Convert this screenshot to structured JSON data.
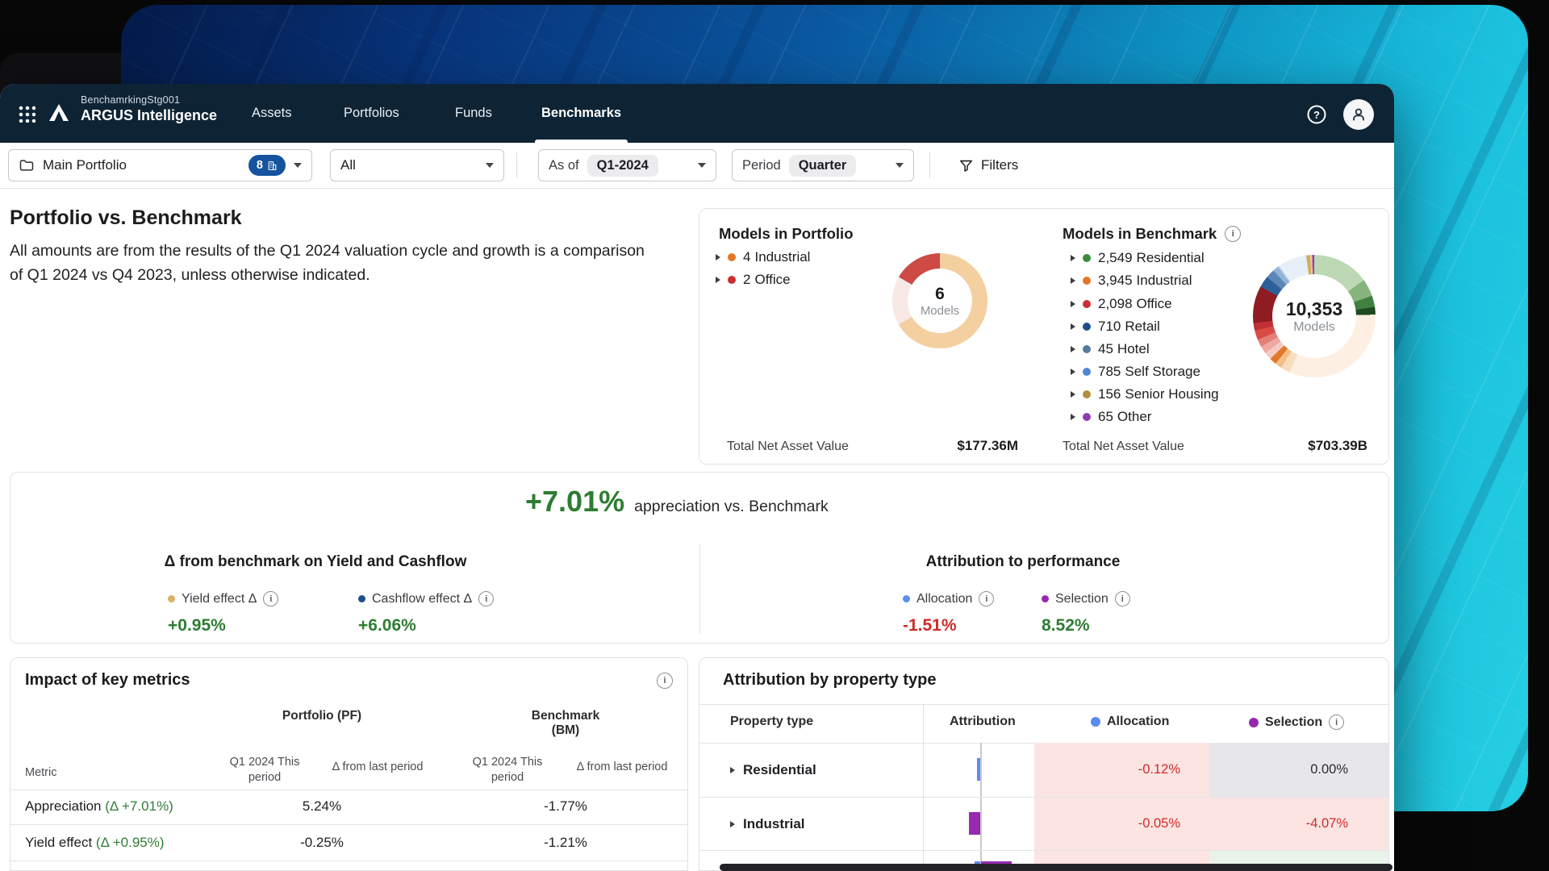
{
  "nav": {
    "environment": "BenchamrkingStg001",
    "product": "ARGUS Intelligence",
    "tabs": [
      "Assets",
      "Portfolios",
      "Funds",
      "Benchmarks"
    ],
    "active_tab": "Benchmarks"
  },
  "filter_bar": {
    "portfolio": {
      "label": "Main Portfolio",
      "badge_count": "8"
    },
    "scope": {
      "value": "All"
    },
    "as_of": {
      "label": "As of",
      "value": "Q1-2024"
    },
    "period": {
      "label": "Period",
      "value": "Quarter"
    },
    "filters_label": "Filters"
  },
  "page": {
    "title": "Portfolio vs. Benchmark",
    "description": "All amounts are from the results of the Q1 2024 valuation cycle and growth is a comparison of Q1 2024 vs Q4 2023, unless otherwise indicated."
  },
  "models_in_portfolio": {
    "title": "Models in Portfolio",
    "legend": [
      {
        "count": "4",
        "label": "Industrial",
        "color": "#e2772a"
      },
      {
        "count": "2",
        "label": "Office",
        "color": "#cc2f2f"
      }
    ],
    "donut": {
      "center_value": "6",
      "center_label": "Models",
      "segments": [
        {
          "color": "#f4cfa0",
          "pct": 66.7
        },
        {
          "color": "#f8e9e6",
          "pct": 16.65
        },
        {
          "color": "#cd4a45",
          "pct": 16.65
        }
      ]
    },
    "total_label": "Total Net Asset Value",
    "total_value": "$177.36M"
  },
  "models_in_benchmark": {
    "title": "Models in Benchmark",
    "legend": [
      {
        "count": "2,549",
        "label": "Residential",
        "color": "#3a8a3f"
      },
      {
        "count": "3,945",
        "label": "Industrial",
        "color": "#e2772a"
      },
      {
        "count": "2,098",
        "label": "Office",
        "color": "#cc2f2f"
      },
      {
        "count": "710",
        "label": "Retail",
        "color": "#1f4e8c"
      },
      {
        "count": "45",
        "label": "Hotel",
        "color": "#56799c"
      },
      {
        "count": "785",
        "label": "Self Storage",
        "color": "#4f86d6"
      },
      {
        "count": "156",
        "label": "Senior Housing",
        "color": "#b0903a"
      },
      {
        "count": "65",
        "label": "Other",
        "color": "#8e3db0"
      }
    ],
    "donut": {
      "center_value": "10,353",
      "center_label": "Models",
      "segments": [
        {
          "color": "#bdd8b4",
          "pct": 15.0
        },
        {
          "color": "#86b47c",
          "pct": 4.6
        },
        {
          "color": "#41803f",
          "pct": 3.0
        },
        {
          "color": "#1d4a21",
          "pct": 2.0
        },
        {
          "color": "#fdf0e2",
          "pct": 32.0
        },
        {
          "color": "#f8dcbd",
          "pct": 2.5
        },
        {
          "color": "#f3bf88",
          "pct": 1.8
        },
        {
          "color": "#e2772a",
          "pct": 1.8
        },
        {
          "color": "#f5cac4",
          "pct": 2.0
        },
        {
          "color": "#efa8a1",
          "pct": 2.0
        },
        {
          "color": "#e67e78",
          "pct": 2.0
        },
        {
          "color": "#da4a45",
          "pct": 2.5
        },
        {
          "color": "#c22f34",
          "pct": 2.0
        },
        {
          "color": "#8e1c22",
          "pct": 9.8
        },
        {
          "color": "#2d5f9b",
          "pct": 3.0
        },
        {
          "color": "#5b86b8",
          "pct": 2.4
        },
        {
          "color": "#93b3d6",
          "pct": 1.5
        },
        {
          "color": "#b8cfe8",
          "pct": 0.4
        },
        {
          "color": "#e7eff9",
          "pct": 7.6
        },
        {
          "color": "#cfae5e",
          "pct": 1.0
        },
        {
          "color": "#e3d194",
          "pct": 0.5
        },
        {
          "color": "#b94fb0",
          "pct": 0.3
        },
        {
          "color": "#7c3fa8",
          "pct": 0.4
        }
      ]
    },
    "total_label": "Total Net Asset Value",
    "total_value": "$703.39B"
  },
  "summary": {
    "headline": {
      "value": "+7.01%",
      "label": "appreciation vs. Benchmark",
      "color": "#2e7d32"
    },
    "yield_cashflow": {
      "title": "Δ from benchmark on Yield and Cashflow",
      "items": [
        {
          "label": "Yield effect Δ",
          "dot_color": "#d8b16a",
          "value": "+0.95%",
          "value_color": "#2e7d32"
        },
        {
          "label": "Cashflow effect Δ",
          "dot_color": "#1f4e8c",
          "value": "+6.06%",
          "value_color": "#2e7d32"
        }
      ]
    },
    "attribution": {
      "title": "Attribution to performance",
      "items": [
        {
          "label": "Allocation",
          "dot_color": "#5b8cf0",
          "value": "-1.51%",
          "value_color": "#cf2a27"
        },
        {
          "label": "Selection",
          "dot_color": "#952ab0",
          "value": "8.52%",
          "value_color": "#2e7d32"
        }
      ]
    }
  },
  "impact_table": {
    "title": "Impact of key metrics",
    "metric_header": "Metric",
    "group_headers": [
      "Portfolio (PF)",
      "Benchmark (BM)"
    ],
    "sub_headers": [
      "Q1 2024 This period",
      "Δ from last period",
      "Q1 2024 This period",
      "Δ from last period"
    ],
    "rows": [
      {
        "metric": "Appreciation",
        "delta": "(Δ +7.01%)",
        "pf_value": "5.24%",
        "bm_value": "-1.77%"
      },
      {
        "metric": "Yield effect",
        "delta": "(Δ +0.95%)",
        "pf_value": "-0.25%",
        "bm_value": "-1.21%"
      }
    ]
  },
  "attribution_table": {
    "title": "Attribution by property type",
    "headers": {
      "property": "Property type",
      "attribution": "Attribution",
      "allocation": "Allocation",
      "selection": "Selection"
    },
    "allocation_dot": "#5b8cf0",
    "selection_dot": "#952ab0",
    "cell_colors": {
      "negative_bg": "#fbe4e2",
      "neutral_bg": "#e7e7e9",
      "positive_bg": "#e9f3ea",
      "negative_text": "#cf2a27",
      "neutral_text": "#2a2c2e"
    },
    "rows": [
      {
        "label": "Residential",
        "allocation": "-0.12%",
        "selection": "0.00%"
      },
      {
        "label": "Industrial",
        "allocation": "-0.05%",
        "selection": "-4.07%"
      },
      {
        "label": "",
        "allocation": "",
        "selection": ""
      }
    ]
  }
}
